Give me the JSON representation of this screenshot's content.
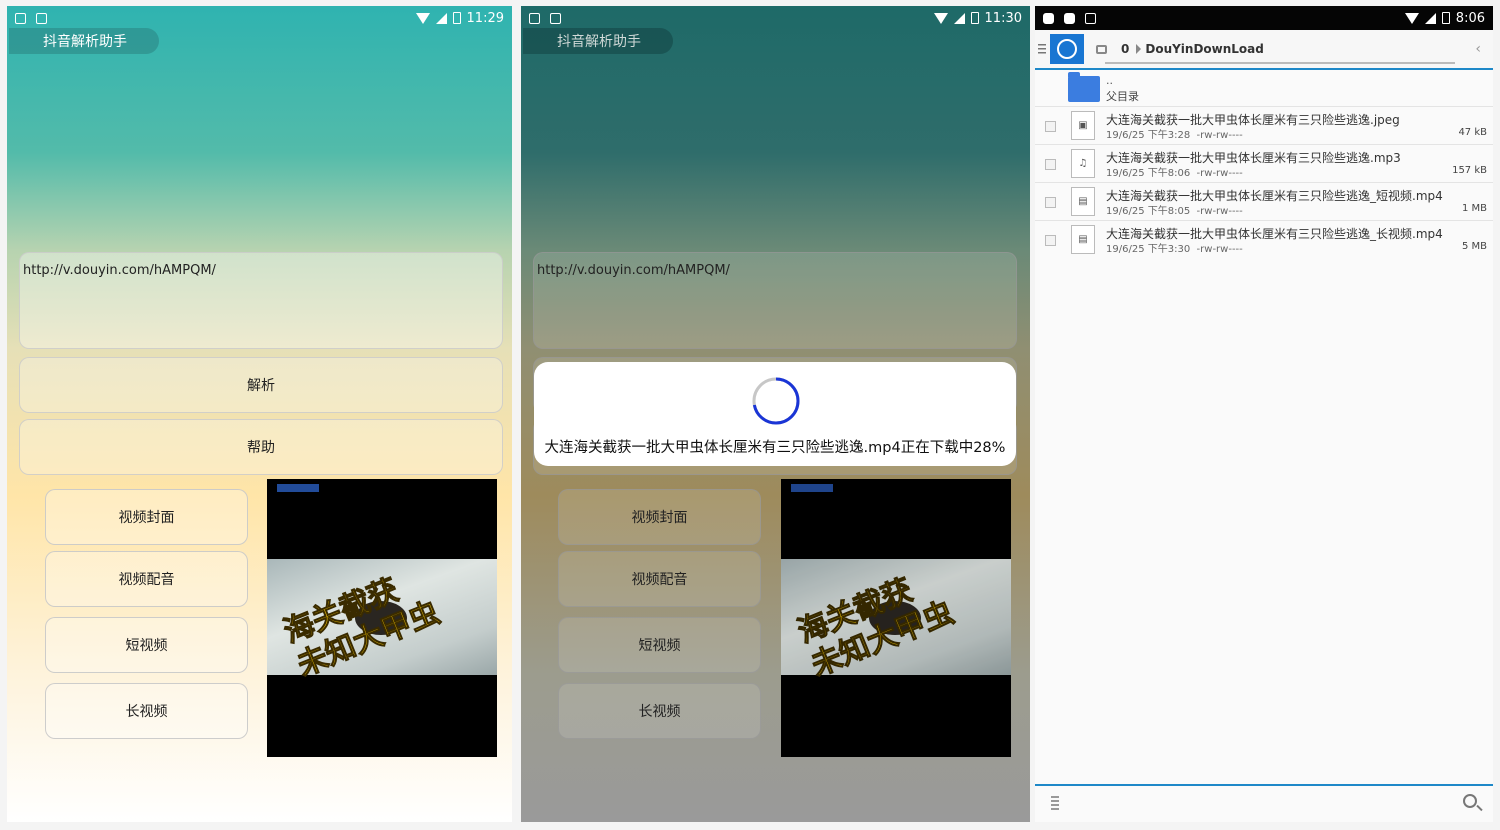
{
  "panels": [
    {
      "time": "11:29",
      "title": "抖音解析助手",
      "url_value": "http://v.douyin.com/hAMPQM/",
      "buttons": {
        "parse": "解析",
        "help": "帮助"
      },
      "options": [
        "视频封面",
        "视频配音",
        "短视频",
        "长视频"
      ],
      "thumbnail": {
        "caption_line1": "海关截获",
        "caption_line2": "未知大甲虫"
      }
    },
    {
      "time": "11:30",
      "title": "抖音解析助手",
      "url_value": "http://v.douyin.com/hAMPQM/",
      "buttons": {
        "parse": "解析",
        "help": "帮助"
      },
      "options": [
        "视频封面",
        "视频配音",
        "短视频",
        "长视频"
      ],
      "thumbnail": {
        "caption_line1": "海关截获",
        "caption_line2": "未知大甲虫"
      },
      "dialog": {
        "message": "大连海关截获一批大甲虫体长厘米有三只险些逃逸.mp4正在下载中28%",
        "progress_percent": 28
      }
    }
  ],
  "file_manager": {
    "time": "8:06",
    "breadcrumb": {
      "index": "0",
      "folder": "DouYinDownLoad"
    },
    "parent": {
      "dots": "..",
      "label": "父目录"
    },
    "files": [
      {
        "name": "大连海关截获一批大甲虫体长厘米有三只险些逃逸.jpeg",
        "date": "19/6/25 下午3:28",
        "perm": "-rw-rw----",
        "size": "47 kB",
        "icon": "image-file-icon"
      },
      {
        "name": "大连海关截获一批大甲虫体长厘米有三只险些逃逸.mp3",
        "date": "19/6/25 下午8:06",
        "perm": "-rw-rw----",
        "size": "157 kB",
        "icon": "audio-file-icon"
      },
      {
        "name": "大连海关截获一批大甲虫体长厘米有三只险些逃逸_短视频.mp4",
        "date": "19/6/25 下午8:05",
        "perm": "-rw-rw----",
        "size": "1 MB",
        "icon": "video-file-icon"
      },
      {
        "name": "大连海关截获一批大甲虫体长厘米有三只险些逃逸_长视频.mp4",
        "date": "19/6/25 下午3:30",
        "perm": "-rw-rw----",
        "size": "5 MB",
        "icon": "video-file-icon"
      }
    ]
  },
  "colors": {
    "accent": "#1e88c8",
    "home": "#1976d2",
    "folder": "#3b7de0",
    "spinner": "#1a35d6"
  }
}
